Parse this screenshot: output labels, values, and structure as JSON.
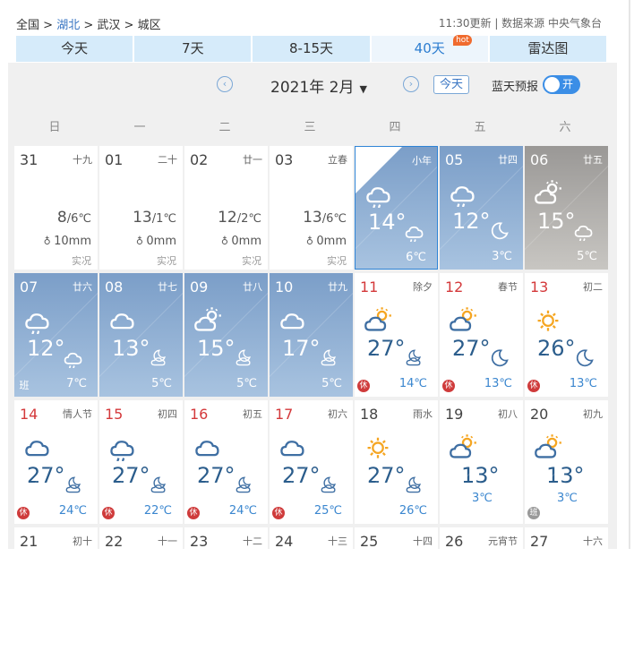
{
  "breadcrumb": {
    "home": "全国",
    "sep1": " > ",
    "province": "湖北",
    "sep2": " > ",
    "city": "武汉",
    "sep3": " > ",
    "district": "城区"
  },
  "source": "11:30更新 | 数据来源 中央气象台",
  "tabs": [
    {
      "label": "今天"
    },
    {
      "label": "7天"
    },
    {
      "label": "8-15天"
    },
    {
      "label": "40天",
      "badge": "hot"
    },
    {
      "label": "雷达图"
    }
  ],
  "controls": {
    "prev": "‹",
    "next": "›",
    "month": "2021年 2月",
    "caret": "▼",
    "today": "今天",
    "bluesky": "蓝天预报",
    "toggle": "开"
  },
  "weekdays": [
    "日",
    "一",
    "二",
    "三",
    "四",
    "五",
    "六"
  ],
  "cells": [
    {
      "day": "31",
      "lunar": "十九",
      "hi": "8",
      "lo": "/6℃",
      "rain": "10mm",
      "note": "实况"
    },
    {
      "day": "01",
      "lunar": "二十",
      "hi": "13",
      "lo": "/1℃",
      "rain": "0mm",
      "note": "实况"
    },
    {
      "day": "02",
      "lunar": "廿一",
      "hi": "12",
      "lo": "/2℃",
      "rain": "0mm",
      "note": "实况"
    },
    {
      "day": "03",
      "lunar": "立春",
      "hi": "13",
      "lo": "/6℃",
      "rain": "0mm",
      "note": "实况"
    },
    {
      "day": "04",
      "lunar": "小年",
      "hi": "14°",
      "lo": "6℃",
      "icon": "rain-cloud",
      "icon2": "rain-cloud"
    },
    {
      "day": "05",
      "lunar": "廿四",
      "hi": "12°",
      "lo": "3℃",
      "icon": "rain-cloud",
      "icon2": "moon"
    },
    {
      "day": "06",
      "lunar": "廿五",
      "hi": "15°",
      "lo": "5℃",
      "icon": "sun-cloud",
      "icon2": "rain-cloud"
    },
    {
      "day": "07",
      "lunar": "廿六",
      "hi": "12°",
      "lo": "7℃",
      "icon": "rain-cloud",
      "icon2": "rain-cloud",
      "badge": "班"
    },
    {
      "day": "08",
      "lunar": "廿七",
      "hi": "13°",
      "lo": "5℃",
      "icon": "cloud",
      "icon2": "moon-cloud"
    },
    {
      "day": "09",
      "lunar": "廿八",
      "hi": "15°",
      "lo": "5℃",
      "icon": "sun-cloud",
      "icon2": "moon-cloud"
    },
    {
      "day": "10",
      "lunar": "廿九",
      "hi": "17°",
      "lo": "5℃",
      "icon": "cloud",
      "icon2": "moon-cloud"
    },
    {
      "day": "11",
      "lunar": "除夕",
      "hi": "27°",
      "lo": "14℃",
      "icon": "sun-cloud",
      "icon2": "moon-cloud",
      "badge": "休"
    },
    {
      "day": "12",
      "lunar": "春节",
      "hi": "27°",
      "lo": "13℃",
      "icon": "sun-cloud",
      "icon2": "moon",
      "badge": "休"
    },
    {
      "day": "13",
      "lunar": "初二",
      "hi": "26°",
      "lo": "13℃",
      "icon": "sun",
      "icon2": "moon",
      "badge": "休"
    },
    {
      "day": "14",
      "lunar": "情人节",
      "hi": "27°",
      "lo": "24℃",
      "icon": "cloud",
      "icon2": "moon-cloud",
      "badge": "休"
    },
    {
      "day": "15",
      "lunar": "初四",
      "hi": "27°",
      "lo": "22℃",
      "icon": "rain-cloud",
      "icon2": "moon-cloud",
      "badge": "休"
    },
    {
      "day": "16",
      "lunar": "初五",
      "hi": "27°",
      "lo": "24℃",
      "icon": "cloud",
      "icon2": "moon-cloud",
      "badge": "休"
    },
    {
      "day": "17",
      "lunar": "初六",
      "hi": "27°",
      "lo": "25℃",
      "icon": "cloud",
      "icon2": "moon-cloud",
      "badge": "休"
    },
    {
      "day": "18",
      "lunar": "雨水",
      "hi": "27°",
      "lo": "26℃",
      "icon": "sun",
      "icon2": "moon-cloud"
    },
    {
      "day": "19",
      "lunar": "初八",
      "hi": "13°",
      "lo": "3℃",
      "icon": "sun-cloud"
    },
    {
      "day": "20",
      "lunar": "初九",
      "hi": "13°",
      "lo": "3℃",
      "icon": "sun-cloud",
      "badge": "班"
    },
    {
      "day": "21",
      "lunar": "初十"
    },
    {
      "day": "22",
      "lunar": "十一"
    },
    {
      "day": "23",
      "lunar": "十二"
    },
    {
      "day": "24",
      "lunar": "十三"
    },
    {
      "day": "25",
      "lunar": "十四"
    },
    {
      "day": "26",
      "lunar": "元宵节"
    },
    {
      "day": "27",
      "lunar": "十六"
    }
  ]
}
